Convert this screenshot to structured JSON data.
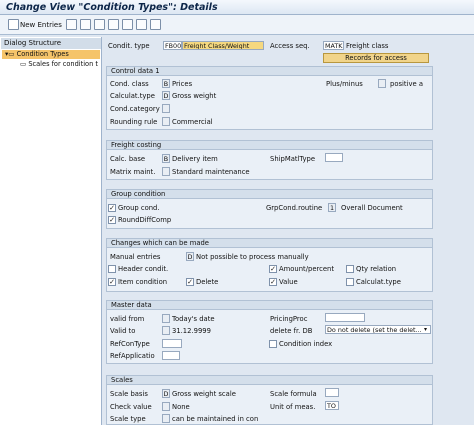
{
  "window": {
    "title": "Change View \"Condition Types\": Details"
  },
  "toolbar": {
    "new_entries": "New Entries"
  },
  "left": {
    "head": "Dialog Structure",
    "items": [
      {
        "label": "Condition Types"
      },
      {
        "label": "Scales for condition t"
      }
    ]
  },
  "header": {
    "condit_type_label": "Condit. type",
    "condit_type_value": "FB00",
    "condit_type_desc": "Freight Class/Weight",
    "access_seq_label": "Access seq.",
    "access_seq_value": "MATK",
    "access_seq_desc": "Freight class",
    "records_btn": "Records for access"
  },
  "control": {
    "head": "Control data 1",
    "cond_class_label": "Cond. class",
    "cond_class_key": "B",
    "cond_class_desc": "Prices",
    "plusminus_label": "Plus/minus",
    "plusminus_desc": "positive a",
    "calc_type_label": "Calculat.type",
    "calc_type_key": "D",
    "calc_type_desc": "Gross weight",
    "cond_category_label": "Cond.category",
    "rounding_label": "Rounding rule",
    "rounding_desc": "Commercial"
  },
  "freight": {
    "head": "Freight costing",
    "calc_base_label": "Calc. base",
    "calc_base_key": "B",
    "calc_base_desc": "Delivery item",
    "matrix_label": "Matrix maint.",
    "matrix_desc": "Standard maintenance",
    "shipmat_label": "ShipMatlType"
  },
  "group": {
    "head": "Group condition",
    "group_cond_label": "Group cond.",
    "group_cond_checked": true,
    "grpcond_routine_label": "GrpCond.routine",
    "grpcond_routine_value": "1",
    "grpcond_routine_desc": "Overall Document",
    "rounddiff_label": "RoundDiffComp",
    "rounddiff_checked": true
  },
  "changes": {
    "head": "Changes which can be made",
    "manual_label": "Manual entries",
    "manual_key": "D",
    "manual_desc": "Not possible to process manually",
    "header_label": "Header condit.",
    "header_checked": false,
    "amount_label": "Amount/percent",
    "amount_checked": true,
    "qty_label": "Qty relation",
    "qty_checked": false,
    "item_label": "Item condition",
    "item_checked": true,
    "delete_label": "Delete",
    "delete_checked": true,
    "value_label": "Value",
    "value_checked": true,
    "calctype_label": "Calculat.type",
    "calctype_checked": false
  },
  "master": {
    "head": "Master data",
    "valid_from_label": "valid from",
    "valid_from_desc": "Today's date",
    "valid_to_label": "Valid to",
    "valid_to_value": "31.12.9999",
    "pricing_proc_label": "PricingProc",
    "delete_db_label": "delete fr. DB",
    "delete_db_value": "Do not delete (set the delet...",
    "refcontype_label": "RefConType",
    "cond_index_label": "Condition index",
    "cond_index_checked": false,
    "refapplic_label": "RefApplicatio"
  },
  "scales": {
    "head": "Scales",
    "scale_basis_label": "Scale basis",
    "scale_basis_key": "D",
    "scale_basis_desc": "Gross weight scale",
    "scale_formula_label": "Scale formula",
    "check_value_label": "Check value",
    "check_value_desc": "None",
    "unit_label": "Unit of meas.",
    "unit_value": "TO",
    "scale_type_label": "Scale type",
    "scale_type_desc": "can be maintained in con"
  },
  "colors": {
    "tree_selected": "#f5c46a",
    "button": "#f1d48a",
    "title": "#0c2548"
  }
}
